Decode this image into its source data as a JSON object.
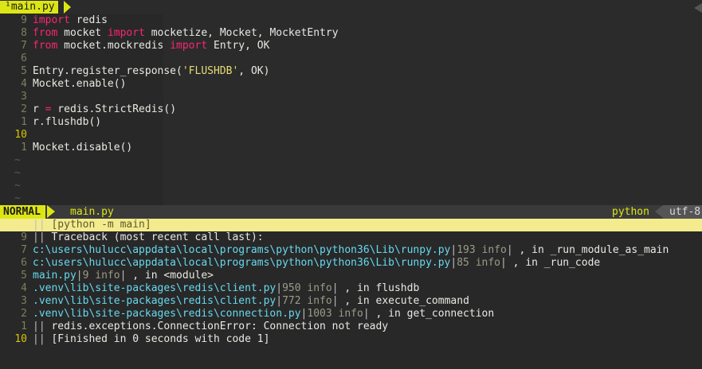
{
  "tab": {
    "label": "main.py",
    "modified_marker": "¹"
  },
  "editor_lines": [
    {
      "num": "9",
      "parts": [
        [
          "kw",
          "import"
        ],
        [
          "t",
          " redis"
        ]
      ]
    },
    {
      "num": "8",
      "parts": [
        [
          "kw",
          "from"
        ],
        [
          "t",
          " mocket "
        ],
        [
          "kw",
          "import"
        ],
        [
          "t",
          " mocketize, Mocket, MocketEntry"
        ]
      ]
    },
    {
      "num": "7",
      "parts": [
        [
          "kw",
          "from"
        ],
        [
          "t",
          " mocket.mockredis "
        ],
        [
          "kw",
          "import"
        ],
        [
          "t",
          " Entry, OK"
        ]
      ]
    },
    {
      "num": "6",
      "parts": []
    },
    {
      "num": "5",
      "parts": [
        [
          "t",
          "Entry.register_response("
        ],
        [
          "str",
          "'FLUSHDB'"
        ],
        [
          "t",
          ", OK)"
        ]
      ]
    },
    {
      "num": "4",
      "parts": [
        [
          "t",
          "Mocket.enable()"
        ]
      ]
    },
    {
      "num": "3",
      "parts": []
    },
    {
      "num": "2",
      "parts": [
        [
          "t",
          "r "
        ],
        [
          "op",
          "="
        ],
        [
          "t",
          " redis.StrictRedis()"
        ]
      ]
    },
    {
      "num": "1",
      "parts": [
        [
          "t",
          "r.flushdb()"
        ]
      ]
    },
    {
      "num": "10",
      "parts": [],
      "current": true
    },
    {
      "num": "1",
      "parts": [
        [
          "t",
          "Mocket.disable()"
        ]
      ]
    }
  ],
  "tilde_count": 4,
  "tilde_char": "~",
  "statusline": {
    "mode": "NORMAL",
    "filename": "main.py",
    "filetype": "python",
    "encoding": "utf-8"
  },
  "quickfix_lines": [
    {
      "num": "",
      "highlight": true,
      "parts": [
        [
          "pipe",
          "|| "
        ],
        [
          "t",
          "[python -m main]"
        ]
      ]
    },
    {
      "num": "9",
      "parts": [
        [
          "pipe",
          "|| "
        ],
        [
          "t",
          "Traceback (most recent call last):"
        ]
      ]
    },
    {
      "num": "7",
      "parts": [
        [
          "path",
          "c:\\users\\hulucc\\appdata\\local\\programs\\python\\python36\\Lib\\runpy.py"
        ],
        [
          "pipe",
          "|"
        ],
        [
          "info",
          "193 info"
        ],
        [
          "pipe",
          "|"
        ],
        [
          "t",
          " , in _run_module_as_main"
        ]
      ]
    },
    {
      "num": "6",
      "parts": [
        [
          "path",
          "c:\\users\\hulucc\\appdata\\local\\programs\\python\\python36\\Lib\\runpy.py"
        ],
        [
          "pipe",
          "|"
        ],
        [
          "info",
          "85 info"
        ],
        [
          "pipe",
          "|"
        ],
        [
          "t",
          " , in _run_code"
        ]
      ]
    },
    {
      "num": "5",
      "parts": [
        [
          "path",
          "main.py"
        ],
        [
          "pipe",
          "|"
        ],
        [
          "info",
          "9 info"
        ],
        [
          "pipe",
          "|"
        ],
        [
          "t",
          " , in <module>"
        ]
      ]
    },
    {
      "num": "4",
      "parts": [
        [
          "path",
          ".venv\\lib\\site-packages\\redis\\client.py"
        ],
        [
          "pipe",
          "|"
        ],
        [
          "info",
          "950 info"
        ],
        [
          "pipe",
          "|"
        ],
        [
          "t",
          " , in flushdb"
        ]
      ]
    },
    {
      "num": "3",
      "parts": [
        [
          "path",
          ".venv\\lib\\site-packages\\redis\\client.py"
        ],
        [
          "pipe",
          "|"
        ],
        [
          "info",
          "772 info"
        ],
        [
          "pipe",
          "|"
        ],
        [
          "t",
          " , in execute_command"
        ]
      ]
    },
    {
      "num": "2",
      "parts": [
        [
          "path",
          ".venv\\lib\\site-packages\\redis\\connection.py"
        ],
        [
          "pipe",
          "|"
        ],
        [
          "info",
          "1003 info"
        ],
        [
          "pipe",
          "|"
        ],
        [
          "t",
          " , in get_connection"
        ]
      ]
    },
    {
      "num": "1",
      "parts": [
        [
          "pipe",
          "|| "
        ],
        [
          "t",
          "redis.exceptions.ConnectionError: Connection not ready"
        ]
      ]
    },
    {
      "num": "10",
      "current": true,
      "parts": [
        [
          "pipe",
          "|| "
        ],
        [
          "t",
          "[Finished in 0 seconds with code 1]"
        ]
      ]
    }
  ],
  "colors": {
    "accent": "#dde615",
    "keyword": "#f92672",
    "string": "#e6db74",
    "path": "#66d9ef",
    "background": "#282828"
  }
}
